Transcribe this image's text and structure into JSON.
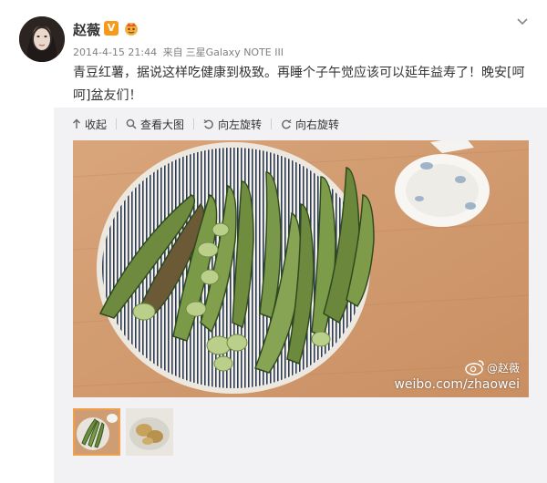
{
  "post": {
    "author": "赵薇",
    "verified_badge": "V",
    "timestamp": "2014-4-15 21:44",
    "source_prefix": "来自",
    "source_device": "三星Galaxy NOTE III",
    "text": "青豆红薯，据说这样吃健康到极致。再睡个子午觉应该可以延年益寿了！晚安[呵呵]盆友们！"
  },
  "toolbar": {
    "collapse_label": "收起",
    "view_large_label": "查看大图",
    "rotate_left_label": "向左旋转",
    "rotate_right_label": "向右旋转"
  },
  "watermark": {
    "user": "@赵薇",
    "url": "weibo.com/zhaowei"
  },
  "icons": {
    "badge": "verified-v-icon",
    "crown": "crown-icon",
    "menu": "chevron-down-icon",
    "collapse": "collapse-arrow-icon",
    "zoom": "magnifier-icon",
    "rotate_left": "rotate-left-icon",
    "rotate_right": "rotate-right-icon",
    "weibo": "weibo-logo-icon"
  },
  "colors": {
    "badge": "#f59a1b",
    "meta_text": "#808080",
    "media_bg": "#f2f2f5",
    "thumb_selected": "#f0a04b"
  }
}
